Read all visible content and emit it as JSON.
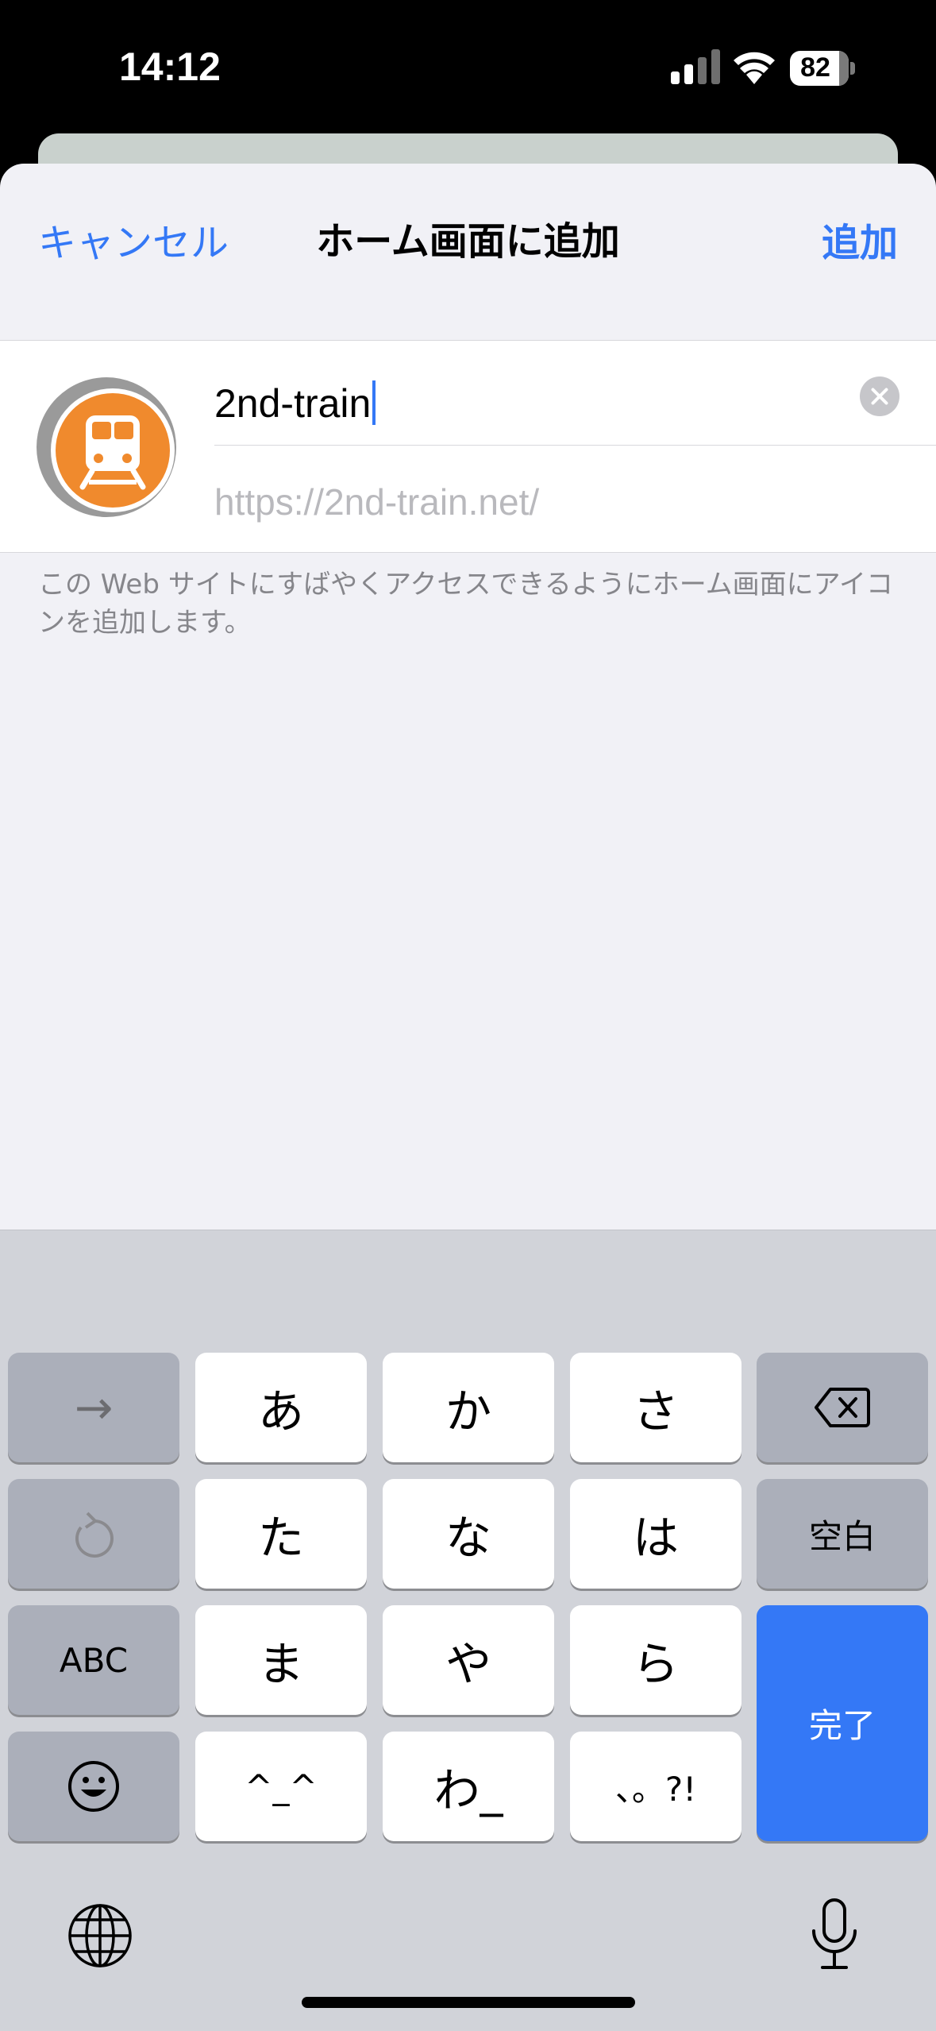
{
  "status_bar": {
    "time": "14:12",
    "battery": "82"
  },
  "sheet": {
    "cancel_label": "キャンセル",
    "title": "ホーム画面に追加",
    "add_label": "追加",
    "name_value": "2nd-train",
    "url": "https://2nd-train.net/",
    "footnote": "この Web サイトにすばやくアクセスできるようにホーム画面にアイコンを追加します。"
  },
  "keyboard": {
    "row1": {
      "next": "→",
      "a": "あ",
      "ka": "か",
      "sa": "さ"
    },
    "row2": {
      "ta": "た",
      "na": "な",
      "ha": "は",
      "space": "空白"
    },
    "row3": {
      "abc": "ABC",
      "ma": "ま",
      "ya": "や",
      "ra": "ら",
      "done": "完了"
    },
    "row4": {
      "kaomoji": "^_^",
      "wa": "わ_",
      "punct": "、。?!"
    }
  },
  "colors": {
    "accent": "#3478f6",
    "icon_orange": "#f08a2d",
    "sheet_bg": "#f1f1f6",
    "keyboard_bg": "#d1d3d9"
  },
  "icons": [
    "signal-icon",
    "wifi-icon",
    "battery-icon",
    "train-app-icon",
    "clear-icon",
    "backspace-icon",
    "undo-icon",
    "emoji-icon",
    "globe-icon",
    "microphone-icon"
  ]
}
